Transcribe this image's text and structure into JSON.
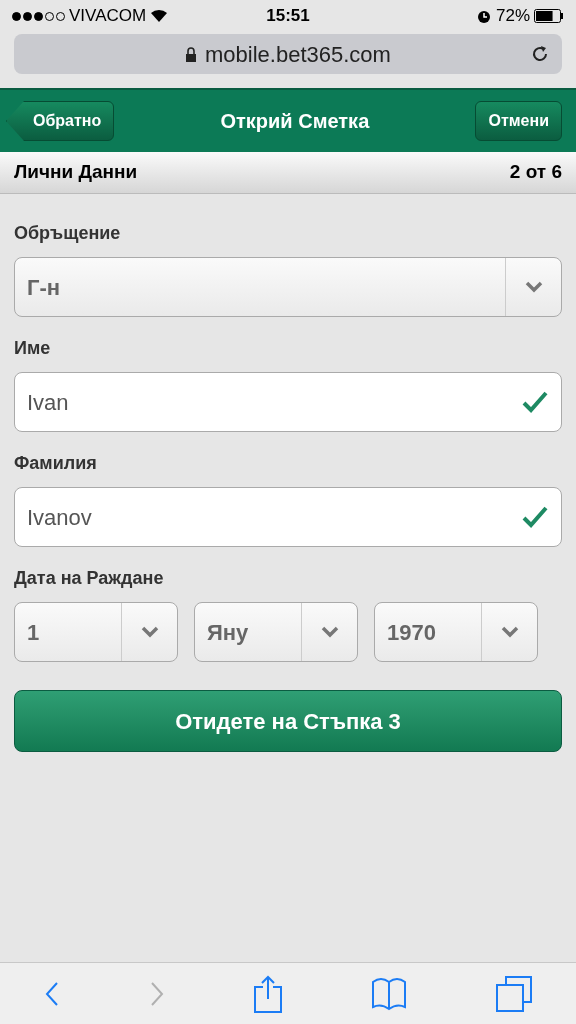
{
  "status_bar": {
    "carrier": "VIVACOM",
    "time": "15:51",
    "battery": "72%"
  },
  "address_bar": {
    "url": "mobile.bet365.com"
  },
  "header": {
    "back": "Обратно",
    "title": "Открий Сметка",
    "cancel": "Отмени"
  },
  "section": {
    "title": "Лични Данни",
    "step": "2 от 6"
  },
  "fields": [
    {
      "kind": "select",
      "label": "Обръщение",
      "value": "Г-н"
    },
    {
      "kind": "text",
      "label": "Име",
      "value": "Ivan",
      "valid": true
    },
    {
      "kind": "text",
      "label": "Фамилия",
      "value": "Ivanov",
      "valid": true
    }
  ],
  "birth_date": {
    "label": "Дата на Раждане",
    "parts": [
      "1",
      "Яну",
      "1970"
    ]
  },
  "submit": "Отидете на Стъпка 3",
  "toolbar": {
    "back_enabled": true,
    "forward_enabled": false
  }
}
